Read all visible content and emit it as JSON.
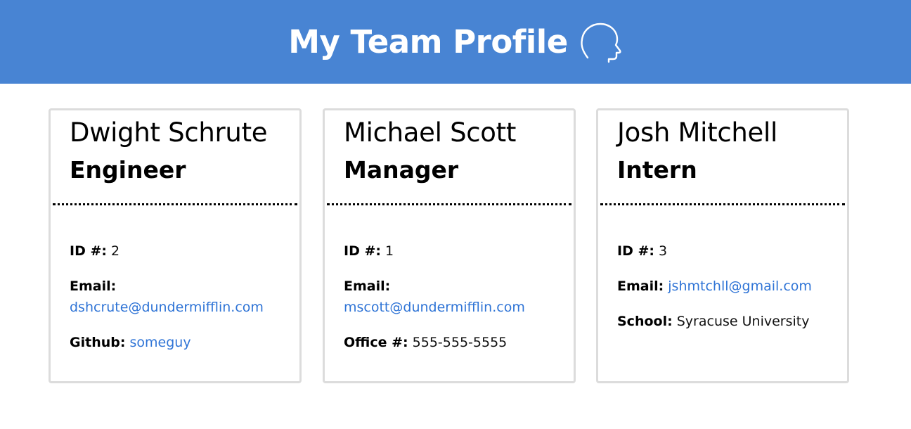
{
  "header": {
    "title": "My Team Profile",
    "icon": "head-profile-icon",
    "background": "#4884d3"
  },
  "cards": [
    {
      "name": "Dwight Schrute",
      "role": "Engineer",
      "id_label": "ID #:",
      "id": "2",
      "email_label": "Email:",
      "email": "dshcrute@dundermifflin.com",
      "extra_label": "Github:",
      "extra": "someguy"
    },
    {
      "name": "Michael Scott",
      "role": "Manager",
      "id_label": "ID #:",
      "id": "1",
      "email_label": "Email:",
      "email": "mscott@dundermifflin.com",
      "extra_label": "Office #:",
      "extra": "555-555-5555"
    },
    {
      "name": "Josh Mitchell",
      "role": "Intern",
      "id_label": "ID #:",
      "id": "3",
      "email_label": "Email:",
      "email": "jshmtchll@gmail.com",
      "extra_label": "School:",
      "extra": "Syracuse University"
    }
  ],
  "colors": {
    "link": "#2f74d6",
    "card_border": "#dcdcdc"
  }
}
